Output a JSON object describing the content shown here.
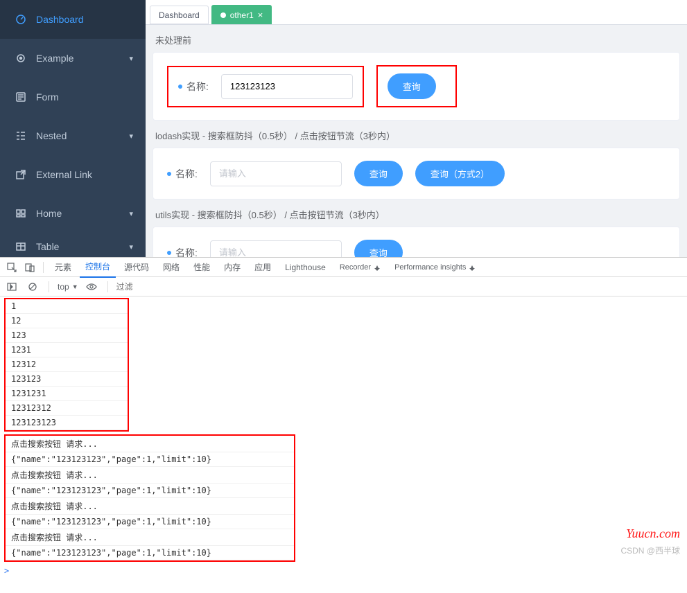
{
  "sidebar": {
    "items": [
      {
        "label": "Dashboard",
        "icon": "dashboard-icon",
        "arrow": false,
        "active": true
      },
      {
        "label": "Example",
        "icon": "example-icon",
        "arrow": true,
        "active": false
      },
      {
        "label": "Form",
        "icon": "form-icon",
        "arrow": false,
        "active": false
      },
      {
        "label": "Nested",
        "icon": "nested-icon",
        "arrow": true,
        "active": false
      },
      {
        "label": "External Link",
        "icon": "link-icon",
        "arrow": false,
        "active": false
      },
      {
        "label": "Home",
        "icon": "home-icon",
        "arrow": true,
        "active": false
      },
      {
        "label": "Table",
        "icon": "table-icon",
        "arrow": true,
        "active": false
      }
    ]
  },
  "tabs": [
    {
      "label": "Dashboard",
      "active": false,
      "closable": false
    },
    {
      "label": "other1",
      "active": true,
      "closable": true
    }
  ],
  "sections": [
    {
      "heading": "未处理前",
      "label": "名称:",
      "value": "123123123",
      "placeholder": "",
      "buttons": [
        "查询"
      ],
      "highlighted": true
    },
    {
      "heading": "lodash实现 - 搜索框防抖（0.5秒） / 点击按钮节流（3秒内）",
      "label": "名称:",
      "value": "",
      "placeholder": "请输入",
      "buttons": [
        "查询",
        "查询（方式2）"
      ],
      "highlighted": false
    },
    {
      "heading": "utils实现 - 搜索框防抖（0.5秒） / 点击按钮节流（3秒内）",
      "label": "名称:",
      "value": "",
      "placeholder": "请输入",
      "buttons": [
        "查询"
      ],
      "highlighted": false
    }
  ],
  "devtools": {
    "tab_labels": [
      "元素",
      "控制台",
      "源代码",
      "网络",
      "性能",
      "内存",
      "应用",
      "Lighthouse"
    ],
    "recorder_label": "Recorder",
    "perf_insights_label": "Performance insights",
    "active_tab": "控制台",
    "context": "top",
    "filter_placeholder": "过滤",
    "logs_group1": [
      "1",
      "12",
      "123",
      "1231",
      "12312",
      "123123",
      "1231231",
      "12312312",
      "123123123"
    ],
    "logs_group2": [
      "点击搜索按钮 请求...",
      "{\"name\":\"123123123\",\"page\":1,\"limit\":10}",
      "点击搜索按钮 请求...",
      "{\"name\":\"123123123\",\"page\":1,\"limit\":10}",
      "点击搜索按钮 请求...",
      "{\"name\":\"123123123\",\"page\":1,\"limit\":10}",
      "点击搜索按钮 请求...",
      "{\"name\":\"123123123\",\"page\":1,\"limit\":10}"
    ],
    "prompt": ">"
  },
  "watermarks": {
    "site": "Yuucn.com",
    "author": "CSDN @西半球"
  }
}
